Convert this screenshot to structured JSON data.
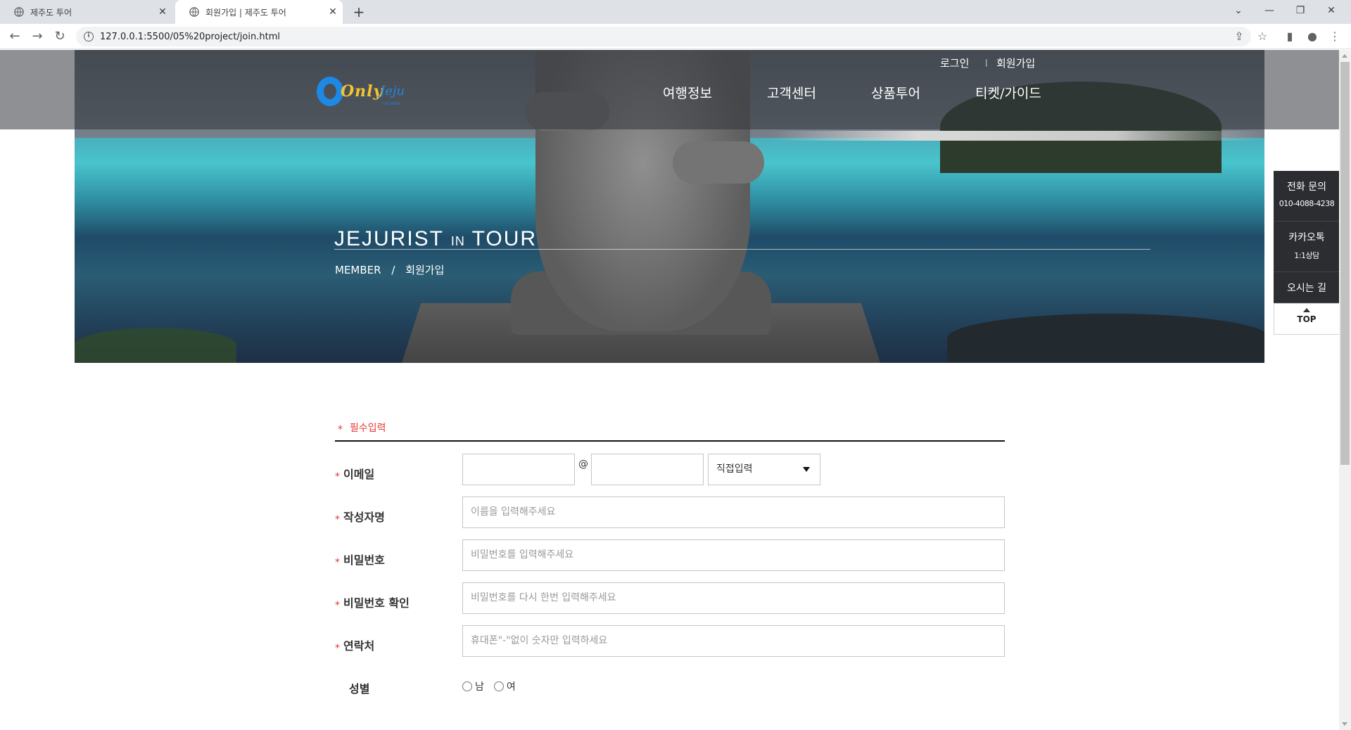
{
  "browser": {
    "tabs": [
      {
        "title": "제주도 투어"
      },
      {
        "title": "회원가입 | 제주도 투어"
      }
    ],
    "url": "127.0.0.1:5500/05%20project/join.html"
  },
  "header": {
    "top_links": {
      "login": "로그인",
      "separator": "|",
      "join": "회원가입"
    },
    "nav": [
      "여행정보",
      "고객센터",
      "상품투어",
      "티켓/가이드"
    ],
    "logo_text_a": "Only",
    "logo_text_b": "Jeju",
    "logo_sub": "ISLAND"
  },
  "hero": {
    "title_a": "JEJURIST",
    "title_b": "IN",
    "title_c": "TOUR",
    "breadcrumb": [
      "MEMBER",
      "/",
      "회원가입"
    ]
  },
  "quick_menu": {
    "phone_label": "전화 문의",
    "phone_number": "010-4088-4238",
    "kakao_label": "카카오톡",
    "kakao_sub": "1:1상담",
    "directions": "오시는 길",
    "top": "TOP"
  },
  "form": {
    "required_heading": "필수입력",
    "star": "*",
    "email_label": "이메일",
    "email_at": "@",
    "email_select": "직접입력",
    "name_label": "작성자명",
    "name_placeholder": "이름을 입력해주세요",
    "password_label": "비밀번호",
    "password_placeholder": "비밀번호를 입력해주세요",
    "password_confirm_label": "비밀번호 확인",
    "password_confirm_placeholder": "비밀번호를 다시 한번 입력해주세요",
    "phone_label": "연락처",
    "phone_placeholder": "휴대폰\"-\"없이 숫자만 입력하세요",
    "gender_label": "성별",
    "gender_options": [
      "남",
      "여"
    ]
  }
}
